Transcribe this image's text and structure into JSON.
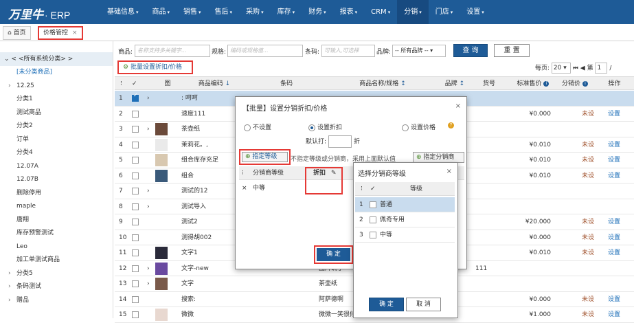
{
  "app": {
    "logo": "万里牛",
    "product": "· ERP"
  },
  "nav": [
    "基础信息",
    "商品",
    "销售",
    "售后",
    "采购",
    "库存",
    "财务",
    "报表",
    "CRM",
    "分销",
    "门店",
    "设置"
  ],
  "nav_active": "分销",
  "tabs": {
    "home": "首页",
    "current": "价格管控",
    "close": "×"
  },
  "sidebar": {
    "root": "< <所有系统分类> >",
    "items": [
      {
        "label": "[未分类商品]",
        "toggle": ""
      },
      {
        "label": "12.25",
        "toggle": "›"
      },
      {
        "label": "分类1",
        "toggle": ""
      },
      {
        "label": "测试商品",
        "toggle": ""
      },
      {
        "label": "分类2",
        "toggle": ""
      },
      {
        "label": "订单",
        "toggle": ""
      },
      {
        "label": "分类4",
        "toggle": ""
      },
      {
        "label": "12.07A",
        "toggle": ""
      },
      {
        "label": "12.07B",
        "toggle": ""
      },
      {
        "label": "删除停用",
        "toggle": ""
      },
      {
        "label": "maple",
        "toggle": ""
      },
      {
        "label": "唐翔",
        "toggle": ""
      },
      {
        "label": "库存预警测试",
        "toggle": ""
      },
      {
        "label": "Leo",
        "toggle": ""
      },
      {
        "label": "加工单测试商品",
        "toggle": ""
      },
      {
        "label": "分类5",
        "toggle": "›"
      },
      {
        "label": "条码测试",
        "toggle": "›"
      },
      {
        "label": "赠品",
        "toggle": "›"
      }
    ]
  },
  "filter": {
    "product_label": "商品:",
    "product_placeholder": "名称支持多关键字...",
    "spec_label": "规格:",
    "spec_placeholder": "编码或规格值...",
    "barcode_label": "条码:",
    "barcode_placeholder": "可输入,可选择",
    "brand_label": "品牌:",
    "brand_value": "-- 所有品牌 --",
    "search_button": "查 询",
    "reset_button": "重 置"
  },
  "bulk_action": "批量设置折扣/价格",
  "pager": {
    "per_page_label": "每页:",
    "per_page": "20",
    "first": "⏮",
    "prev": "◀",
    "page_label": "第",
    "page": "1",
    "sep": "/"
  },
  "table": {
    "headers": [
      "",
      "",
      "",
      "图",
      "商品编码",
      "条码",
      "商品名称/规格",
      "品牌",
      "货号",
      "标准售价",
      "分销价",
      "操作"
    ],
    "sort_arrow": "↕",
    "down_arrow": "↓",
    "info": "i",
    "rows": [
      {
        "n": "1",
        "code": ": 呵呵",
        "barcode": "",
        "name": "",
        "brand": "",
        "itemno": "",
        "price": "",
        "dist": "",
        "op": "",
        "expand": "›",
        "img": "",
        "checked": true
      },
      {
        "n": "2",
        "code": "速度111",
        "barcode": "",
        "name": "",
        "brand": "",
        "itemno": "",
        "price": "¥0.000",
        "dist": "未设",
        "op": "设置",
        "expand": "",
        "img": "",
        "checked": false
      },
      {
        "n": "3",
        "code": "茶壶纸",
        "barcode": "",
        "name": "",
        "brand": "",
        "itemno": "",
        "price": "",
        "dist": "",
        "op": "",
        "expand": "›",
        "img": "#6b4a3a",
        "checked": false
      },
      {
        "n": "4",
        "code": "茉莉花。,",
        "barcode": "",
        "name": "",
        "brand": "",
        "itemno": "",
        "price": "¥0.010",
        "dist": "未设",
        "op": "设置",
        "expand": "",
        "img": "#eaeaea",
        "checked": false
      },
      {
        "n": "5",
        "code": "组合库存充足",
        "barcode": "",
        "name": "",
        "brand": "",
        "itemno": "",
        "price": "¥0.010",
        "dist": "未设",
        "op": "设置",
        "expand": "",
        "img": "#d8c8b0",
        "checked": false
      },
      {
        "n": "6",
        "code": "组合",
        "barcode": "",
        "name": "",
        "brand": "",
        "itemno": "",
        "price": "¥0.010",
        "dist": "未设",
        "op": "设置",
        "expand": "",
        "img": "#3a5a7a",
        "checked": false
      },
      {
        "n": "7",
        "code": "测试的12",
        "barcode": "",
        "name": "",
        "brand": "",
        "itemno": "",
        "price": "",
        "dist": "",
        "op": "",
        "expand": "›",
        "img": "",
        "checked": false
      },
      {
        "n": "8",
        "code": "测试导入",
        "barcode": "",
        "name": "",
        "brand": "",
        "itemno": "",
        "price": "",
        "dist": "",
        "op": "",
        "expand": "›",
        "img": "",
        "checked": false
      },
      {
        "n": "9",
        "code": "测试2",
        "barcode": "",
        "name": "",
        "brand": "",
        "itemno": "",
        "price": "¥20.000",
        "dist": "未设",
        "op": "设置",
        "expand": "",
        "img": "",
        "checked": false
      },
      {
        "n": "10",
        "code": "测得胡002",
        "barcode": "",
        "name": "",
        "brand": "",
        "itemno": "",
        "price": "¥0.000",
        "dist": "未设",
        "op": "设置",
        "expand": "",
        "img": "",
        "checked": false
      },
      {
        "n": "11",
        "code": "文字1",
        "barcode": "",
        "name": "",
        "brand": "",
        "itemno": "",
        "price": "¥0.010",
        "dist": "未设",
        "op": "设置",
        "expand": "",
        "img": "#2a2a3a",
        "checked": false
      },
      {
        "n": "12",
        "code": "文字-new",
        "barcode": "",
        "name": "图片确了-",
        "brand": "",
        "itemno": "111",
        "price": "",
        "dist": "",
        "op": "",
        "expand": "›",
        "img": "#6a4aa0",
        "checked": false
      },
      {
        "n": "13",
        "code": "文字",
        "barcode": "",
        "name": "茶壶纸",
        "brand": "",
        "itemno": "",
        "price": "",
        "dist": "",
        "op": "",
        "expand": "›",
        "img": "#7a5a4a",
        "checked": false
      },
      {
        "n": "14",
        "code": "搜索:",
        "barcode": "",
        "name": "阿萨德啊",
        "brand": "",
        "itemno": "",
        "price": "¥0.000",
        "dist": "未设",
        "op": "设置",
        "expand": "",
        "img": "",
        "checked": false
      },
      {
        "n": "15",
        "code": "微微",
        "barcode": "",
        "name": "微微一笑很倾",
        "brand": "",
        "itemno": "",
        "price": "¥1.000",
        "dist": "未设",
        "op": "设置",
        "expand": "",
        "img": "#e8d8d0",
        "checked": false
      }
    ]
  },
  "dialog1": {
    "title": "【批量】设置分销折扣/价格",
    "close": "×",
    "radio_none": "不设置",
    "radio_discount": "设置折扣",
    "radio_price": "设置价格",
    "help": "?",
    "default_discount_label": "默认打:",
    "discount_unit": "折",
    "assign_level_button": "指定等级",
    "assign_level_plus": "⊕",
    "note": "不指定等级或分销商，采用上面默认值",
    "assign_distributor_button": "指定分销商",
    "grid_header_level": "分销商等级",
    "grid_header_discount": "折扣",
    "grid_edit_icon": "✎",
    "grid_row_level": "中等",
    "grid_row_delete": "×",
    "ok_button": "确 定"
  },
  "dialog2": {
    "title": "选择分销商等级",
    "close": "×",
    "header_level": "等级",
    "rows": [
      {
        "n": "1",
        "label": "普通",
        "selected": true
      },
      {
        "n": "2",
        "label": "佩奇专用",
        "selected": false
      },
      {
        "n": "3",
        "label": "中等",
        "selected": false
      }
    ],
    "ok_button": "确 定",
    "cancel_button": "取 消"
  },
  "colors": {
    "nav_bg": "#1e5b97",
    "highlight": "#e53935",
    "link": "#1e6fb8",
    "unset": "#a0522d",
    "row_selected": "#c9dcee"
  },
  "icons": {
    "home": "home-icon",
    "gear": "gear-icon",
    "check": "check-icon",
    "menu": "menu-icon"
  }
}
